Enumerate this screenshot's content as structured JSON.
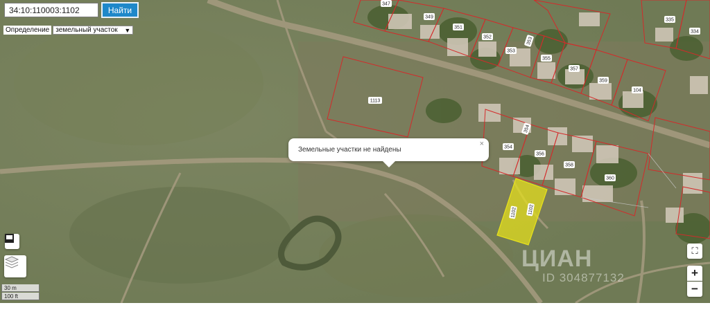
{
  "search": {
    "value": "34:10:110003:1102",
    "button_label": "Найти"
  },
  "mode": {
    "label": "Определение",
    "selected": "земельный участок"
  },
  "popup": {
    "message": "Земельные участки не найдены",
    "close": "×"
  },
  "plots": [
    {
      "number": "347"
    },
    {
      "number": "349"
    },
    {
      "number": "351"
    },
    {
      "number": "352"
    },
    {
      "number": "353"
    },
    {
      "number": "353"
    },
    {
      "number": "355"
    },
    {
      "number": "357"
    },
    {
      "number": "359"
    },
    {
      "number": "104"
    },
    {
      "number": "335"
    },
    {
      "number": "334"
    },
    {
      "number": "1113"
    },
    {
      "number": "354"
    },
    {
      "number": "354"
    },
    {
      "number": "356"
    },
    {
      "number": "358"
    },
    {
      "number": "360"
    }
  ],
  "selected_plot": {
    "label_a": "1102",
    "label_b": "1102",
    "color": "#e8e21a"
  },
  "controls": {
    "fullscreen": "⛶",
    "zoom_in": "+",
    "zoom_out": "−"
  },
  "scale": {
    "metric": "30 m",
    "imperial": "100 ft"
  },
  "watermark": {
    "brand": "ЦИАН",
    "id": "ID 304877132"
  },
  "colors": {
    "boundary": "#d42a2a",
    "accent": "#1e88c9"
  }
}
